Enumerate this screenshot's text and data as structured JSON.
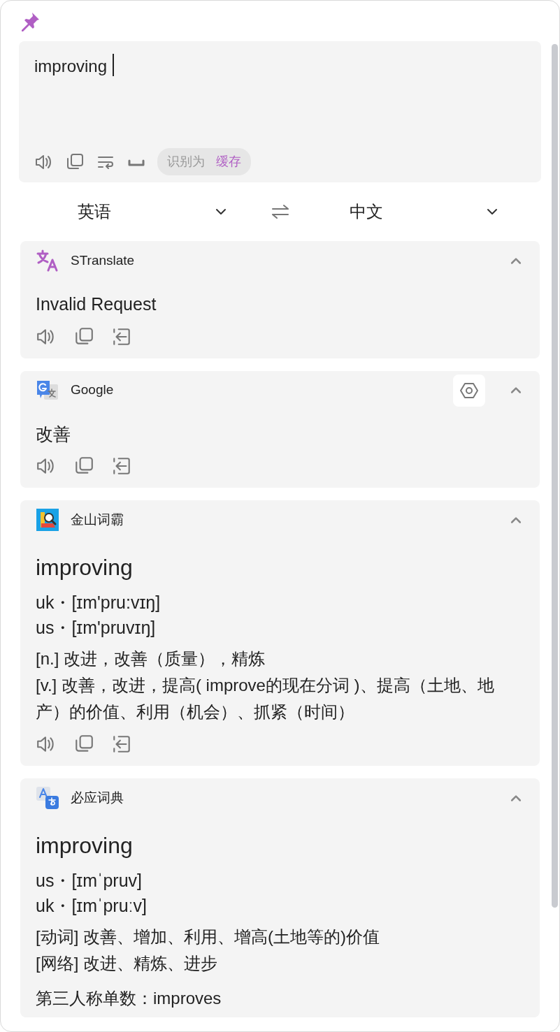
{
  "pinned": true,
  "input": {
    "value": "improving",
    "detected_label": "识别为",
    "detected_value": "缓存"
  },
  "languages": {
    "source": "英语",
    "target": "中文"
  },
  "services": [
    {
      "name": "STranslate",
      "kind": "text",
      "expanded": true,
      "settings_button": false,
      "result": "Invalid Request",
      "actions": true
    },
    {
      "name": "Google",
      "kind": "text",
      "expanded": true,
      "settings_button": true,
      "result": "改善",
      "actions": true
    },
    {
      "name": "金山词霸",
      "kind": "dict",
      "expanded": true,
      "settings_button": false,
      "word": "improving",
      "phonetics": [
        "uk・[ɪm'pru:vɪŋ]",
        "us・[ɪm'pruvɪŋ]"
      ],
      "definitions": [
        "[n.] 改进，改善（质量），精炼",
        "[v.] 改善，改进，提高( improve的现在分词 )、提高（土地、地产）的价值、利用（机会）、抓紧（时间）"
      ],
      "actions": true
    },
    {
      "name": "必应词典",
      "kind": "dict",
      "expanded": true,
      "settings_button": false,
      "word": "improving",
      "phonetics": [
        "us・[ɪmˈpruv]",
        "uk・[ɪmˈpruːv]"
      ],
      "definitions": [
        "[动词] 改善、增加、利用、增高(土地等的)价值",
        "[网络] 改进、精炼、进步"
      ],
      "forms": "第三人称单数：improves",
      "actions": false
    }
  ]
}
